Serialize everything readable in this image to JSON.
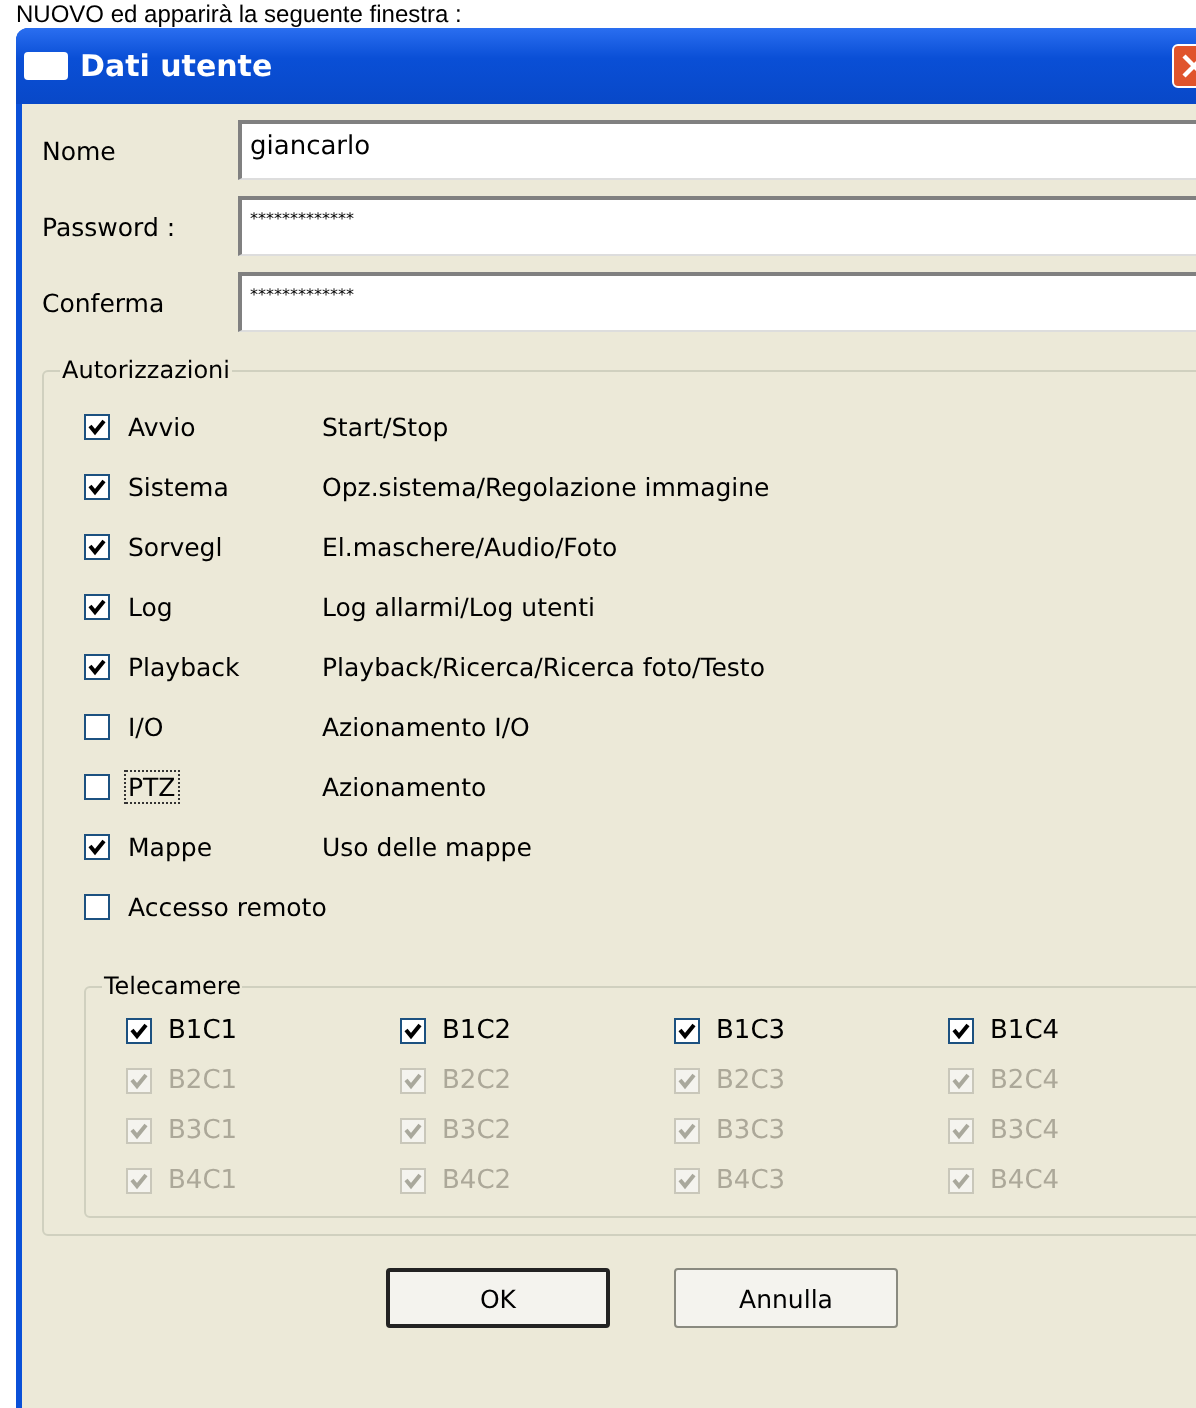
{
  "caption": "NUOVO ed apparirà la seguente finestra :",
  "window": {
    "title": "Dati utente"
  },
  "fields": [
    {
      "label": "Nome",
      "value": "giancarlo"
    },
    {
      "label": "Password :",
      "value": "*************"
    },
    {
      "label": "Conferma",
      "value": "*************"
    }
  ],
  "permissions": {
    "title": "Autorizzazioni",
    "items": [
      {
        "label": "Avvio",
        "description": "Start/Stop",
        "checked": true,
        "focused": false
      },
      {
        "label": "Sistema",
        "description": "Opz.sistema/Regolazione immagine",
        "checked": true,
        "focused": false
      },
      {
        "label": "Sorvegl",
        "description": "El.maschere/Audio/Foto",
        "checked": true,
        "focused": false
      },
      {
        "label": "Log",
        "description": "Log allarmi/Log utenti",
        "checked": true,
        "focused": false
      },
      {
        "label": "Playback",
        "description": "Playback/Ricerca/Ricerca foto/Testo",
        "checked": true,
        "focused": false
      },
      {
        "label": "I/O",
        "description": "Azionamento I/O",
        "checked": false,
        "focused": false
      },
      {
        "label": "PTZ",
        "description": "Azionamento",
        "checked": false,
        "focused": true
      },
      {
        "label": "Mappe",
        "description": "Uso delle mappe",
        "checked": true,
        "focused": false
      },
      {
        "label": "Accesso remoto",
        "checked": false,
        "focused": false
      }
    ]
  },
  "cameras": {
    "title": "Telecamere",
    "items": [
      {
        "label": "B1C1",
        "checked": true,
        "disabled": false
      },
      {
        "label": "B1C2",
        "checked": true,
        "disabled": false
      },
      {
        "label": "B1C3",
        "checked": true,
        "disabled": false
      },
      {
        "label": "B1C4",
        "checked": true,
        "disabled": false
      },
      {
        "label": "B2C1",
        "checked": true,
        "disabled": true
      },
      {
        "label": "B2C2",
        "checked": true,
        "disabled": true
      },
      {
        "label": "B2C3",
        "checked": true,
        "disabled": true
      },
      {
        "label": "B2C4",
        "checked": true,
        "disabled": true
      },
      {
        "label": "B3C1",
        "checked": true,
        "disabled": true
      },
      {
        "label": "B3C2",
        "checked": true,
        "disabled": true
      },
      {
        "label": "B3C3",
        "checked": true,
        "disabled": true
      },
      {
        "label": "B3C4",
        "checked": true,
        "disabled": true
      },
      {
        "label": "B4C1",
        "checked": true,
        "disabled": true
      },
      {
        "label": "B4C2",
        "checked": true,
        "disabled": true
      },
      {
        "label": "B4C3",
        "checked": true,
        "disabled": true
      },
      {
        "label": "B4C4",
        "checked": true,
        "disabled": true
      }
    ]
  },
  "buttons": [
    {
      "label": "OK",
      "default": true
    },
    {
      "label": "Annulla",
      "default": false
    }
  ]
}
